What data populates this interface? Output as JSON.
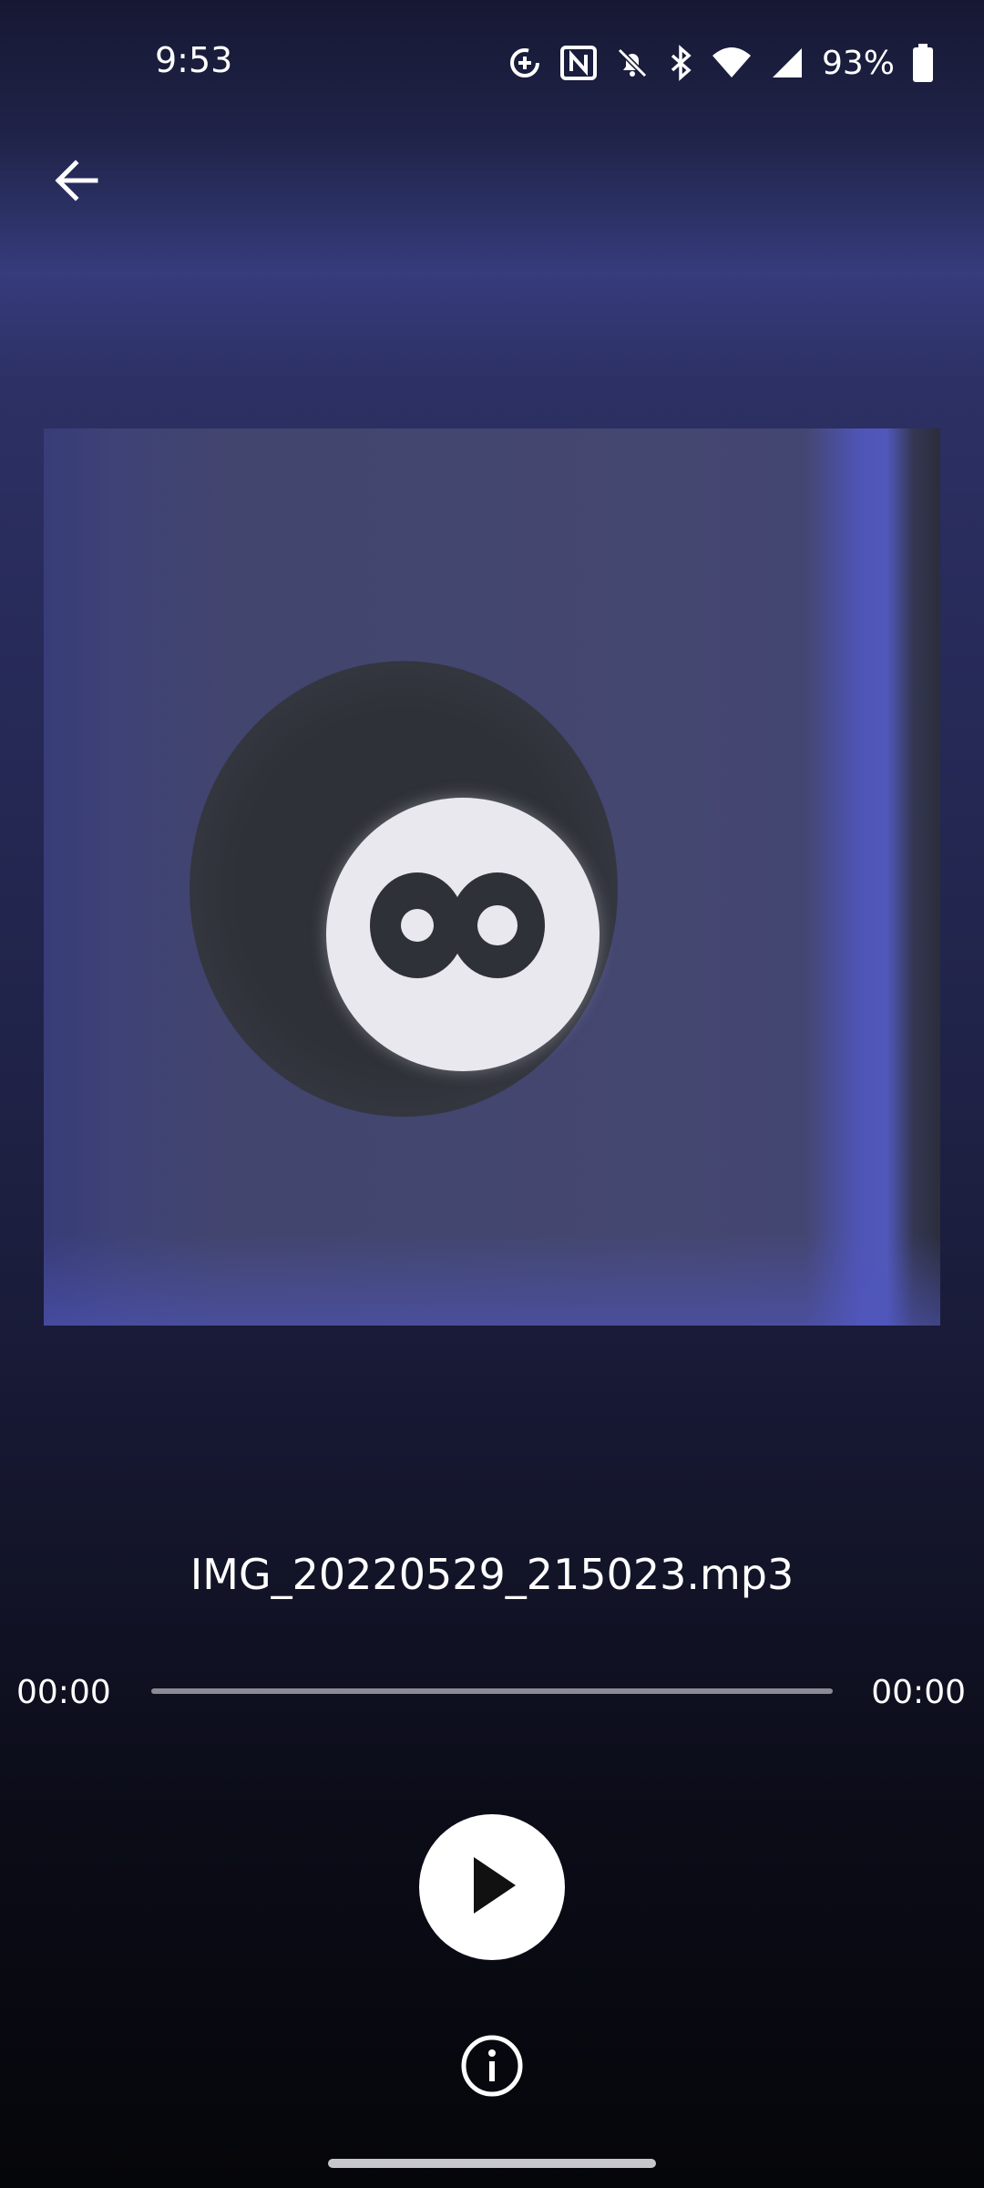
{
  "status_bar": {
    "time": "9:53",
    "battery_percent": "93%",
    "icons": [
      "data-saver-icon",
      "nfc-icon",
      "notifications-off-icon",
      "bluetooth-icon",
      "wifi-icon",
      "cell-signal-icon",
      "battery-icon"
    ]
  },
  "toolbar": {
    "back_icon": "arrow-back-icon"
  },
  "player": {
    "track_name": "IMG_20220529_215023.mp3",
    "current_time": "00:00",
    "total_time": "00:00",
    "progress": 0,
    "play_icon": "play-icon",
    "info_icon": "info-icon"
  },
  "colors": {
    "accent_white": "#ffffff",
    "seek_track": "#8a8b94",
    "background_top": "#1f2348",
    "background_bottom": "#05060a"
  }
}
